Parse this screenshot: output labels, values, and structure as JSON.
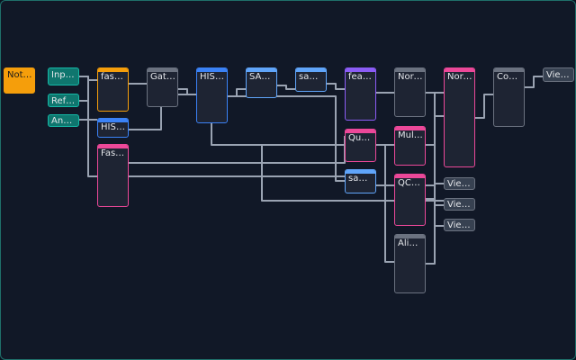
{
  "colors": {
    "teal": "#14b8a6",
    "orange": "#f59e0b",
    "blue": "#3b82f6",
    "lightblue": "#60a5fa",
    "purple": "#8b5cf6",
    "pink": "#ec4899",
    "gray": "#6b7280"
  },
  "nodes": {
    "notes": "Notes",
    "input": "Input…",
    "refer": "Refer…",
    "annot": "Annot…",
    "fastp": "fastp…",
    "hisat_small": "HISAT…",
    "fastqc": "FastQC",
    "gate": "Gate…",
    "hisat_big": "HISAT…",
    "sam": "SAM t…",
    "samto1": "samto…",
    "featu": "featu…",
    "quali": "Quali…",
    "samto2": "samto…",
    "norma1": "Norma…",
    "multi": "Multi…",
    "qcda": "QC Da…",
    "align": "Align…",
    "norma2": "Norma…",
    "count": "Count…",
    "view1": "View…",
    "view2": "View…",
    "view3": "View…",
    "view4": "View…"
  }
}
